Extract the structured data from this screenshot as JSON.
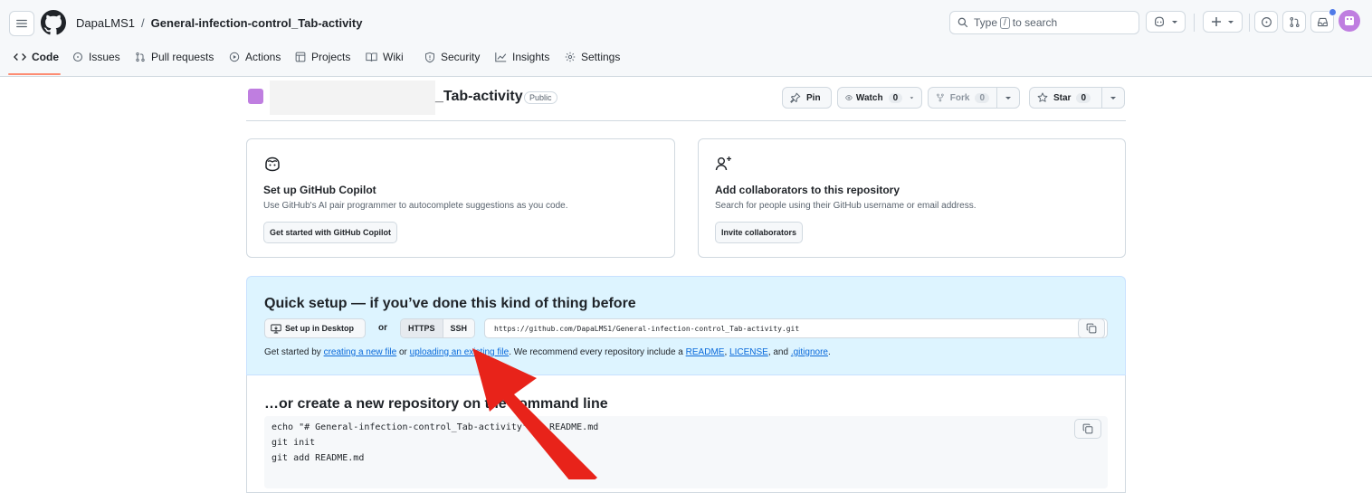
{
  "header": {
    "owner": "DapaLMS1",
    "separator": "/",
    "repo": "General-infection-control_Tab-activity",
    "search_prefix": "Type",
    "search_key": "/",
    "search_suffix": "to search"
  },
  "tabs": [
    {
      "label": "Code",
      "icon": "code-icon"
    },
    {
      "label": "Issues",
      "icon": "issue-icon"
    },
    {
      "label": "Pull requests",
      "icon": "pull-request-icon"
    },
    {
      "label": "Actions",
      "icon": "play-icon"
    },
    {
      "label": "Projects",
      "icon": "table-icon"
    },
    {
      "label": "Wiki",
      "icon": "book-icon"
    },
    {
      "label": "Security",
      "icon": "shield-icon"
    },
    {
      "label": "Insights",
      "icon": "graph-icon"
    },
    {
      "label": "Settings",
      "icon": "gear-icon"
    }
  ],
  "repo_header": {
    "name_suffix": "_Tab-activity",
    "visibility": "Public",
    "pin_label": "Pin",
    "watch_label": "Watch",
    "watch_count": "0",
    "fork_label": "Fork",
    "fork_count": "0",
    "star_label": "Star",
    "star_count": "0"
  },
  "copilot_card": {
    "title": "Set up GitHub Copilot",
    "description": "Use GitHub's AI pair programmer to autocomplete suggestions as you code.",
    "button": "Get started with GitHub Copilot"
  },
  "collab_card": {
    "title": "Add collaborators to this repository",
    "description": "Search for people using their GitHub username or email address.",
    "button": "Invite collaborators"
  },
  "quick_setup": {
    "title": "Quick setup — if you’ve done this kind of thing before",
    "desktop_button": "Set up in Desktop",
    "or_label": "or",
    "https_label": "HTTPS",
    "ssh_label": "SSH",
    "url": "https://github.com/DapaLMS1/General-infection-control_Tab-activity.git",
    "text_1": "Get started by ",
    "link_new_file": "creating a new file",
    "text_2": " or ",
    "link_upload": "uploading an existing file",
    "text_3": ". We recommend every repository include a ",
    "link_readme": "README",
    "text_4": ", ",
    "link_license": "LICENSE",
    "text_5": ", and ",
    "link_gitignore": ".gitignore",
    "text_6": "."
  },
  "command_line": {
    "title": "…or create a new repository on the command line",
    "lines": [
      "echo \"# General-infection-control_Tab-activity\" >> README.md",
      "git init",
      "git add README.md"
    ]
  },
  "colors": {
    "accent_link": "#0969da",
    "tab_underline": "#fd8c73",
    "quick_setup_bg": "#ddf4ff",
    "annotation_arrow": "#e8231a",
    "avatar": "#bf7ee0"
  }
}
